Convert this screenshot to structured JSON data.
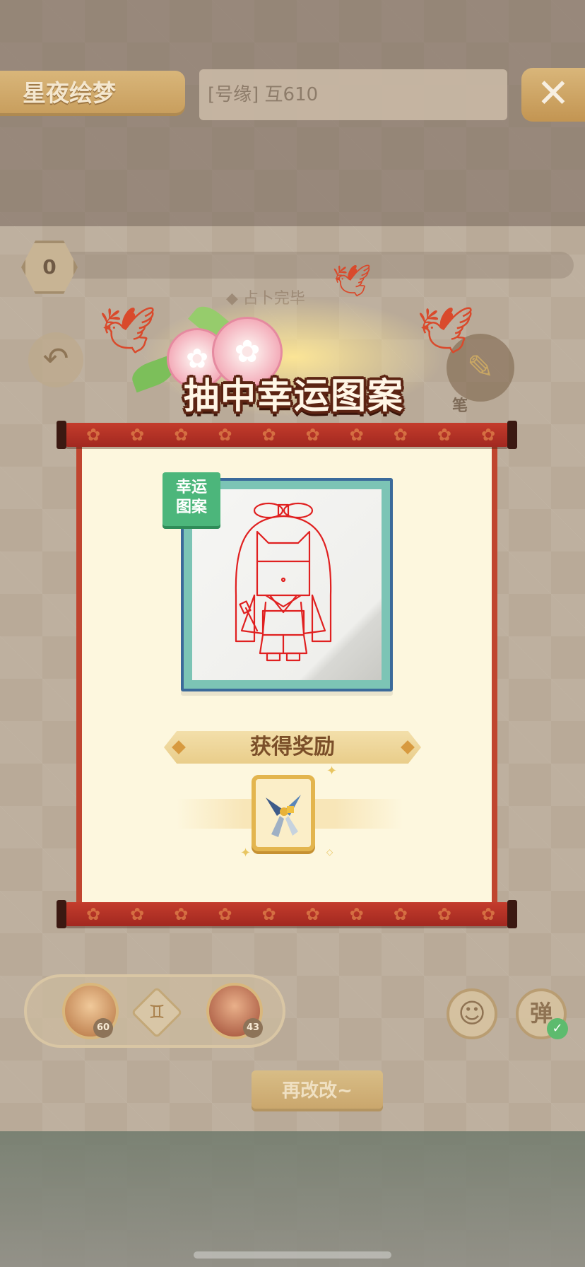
{
  "header": {
    "title": "星夜绘梦",
    "room_text": "[号缘] 互610",
    "close_icon": "close-icon"
  },
  "progress": {
    "value": "0",
    "status": "占卜完毕"
  },
  "controls": {
    "undo_icon": "undo-icon",
    "brush_icon": "brush-icon",
    "brush_label": "笔"
  },
  "result": {
    "title": "抽中幸运图案",
    "tag_line1": "幸运",
    "tag_line2": "图案",
    "reward_label": "获得奖励",
    "reward_icon": "scissors-icon"
  },
  "players": [
    {
      "level": "60"
    },
    {
      "level": "43"
    }
  ],
  "bottom": {
    "emoji_icon": "smiley-icon",
    "danmaku_label": "弹",
    "retry_label": "再改改~"
  },
  "colors": {
    "scroll_red": "#c0452f",
    "paper": "#fdf7de",
    "tag_green": "#4cb67b",
    "card_teal": "#7cc4b5",
    "drawing_red": "#e02020"
  }
}
